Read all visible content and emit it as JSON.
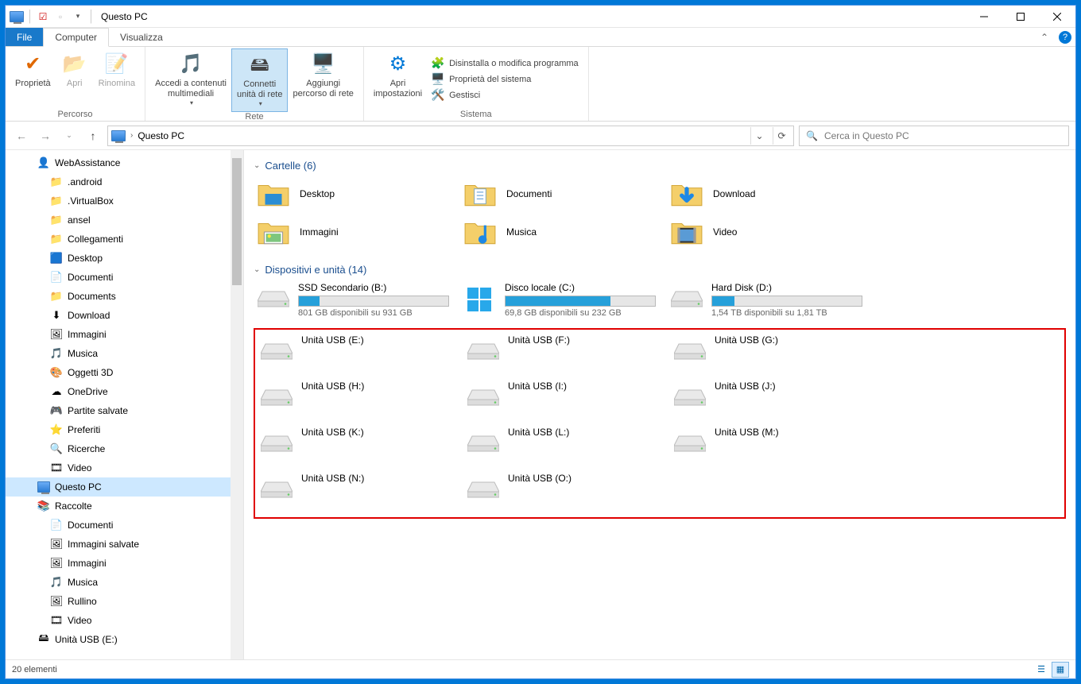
{
  "window": {
    "title": "Questo PC",
    "tabs": {
      "file": "File",
      "computer": "Computer",
      "view": "Visualizza"
    }
  },
  "ribbon": {
    "percorso": {
      "label": "Percorso",
      "properties": "Proprietà",
      "open": "Apri",
      "rename": "Rinomina"
    },
    "rete": {
      "label": "Rete",
      "media": "Accedi a contenuti\nmultimediali",
      "mapdrive": "Connetti\nunità di rete",
      "addloc": "Aggiungi\npercorso di rete"
    },
    "sistema": {
      "label": "Sistema",
      "settings": "Apri\nimpostazioni",
      "uninstall": "Disinstalla o modifica programma",
      "sysprops": "Proprietà del sistema",
      "manage": "Gestisci"
    }
  },
  "address": {
    "location": "Questo PC",
    "search_placeholder": "Cerca in Questo PC"
  },
  "nav": {
    "user": "WebAssistance",
    "items_user": [
      ".android",
      ".VirtualBox",
      "ansel",
      "Collegamenti",
      "Desktop",
      "Documenti",
      "Documents",
      "Download",
      "Immagini",
      "Musica",
      "Oggetti 3D",
      "OneDrive",
      "Partite salvate",
      "Preferiti",
      "Ricerche",
      "Video"
    ],
    "thispc": "Questo PC",
    "raccolte": "Raccolte",
    "items_raccolte": [
      "Documenti",
      "Immagini salvate",
      "Immagini",
      "Musica",
      "Rullino",
      "Video"
    ],
    "usb": "Unità USB (E:)"
  },
  "content": {
    "folders_header": "Cartelle (6)",
    "drives_header": "Dispositivi e unità (14)",
    "folders": [
      "Desktop",
      "Documenti",
      "Download",
      "Immagini",
      "Musica",
      "Video"
    ],
    "drives_storage": [
      {
        "name": "SSD Secondario (B:)",
        "info": "801 GB disponibili su 931 GB",
        "fill": 14
      },
      {
        "name": "Disco locale (C:)",
        "info": "69,8 GB disponibili su 232 GB",
        "fill": 70,
        "os": true
      },
      {
        "name": "Hard Disk (D:)",
        "info": "1,54 TB disponibili su 1,81 TB",
        "fill": 15
      }
    ],
    "drives_usb": [
      "Unità USB (E:)",
      "Unità USB (F:)",
      "Unità USB (G:)",
      "Unità USB (H:)",
      "Unità USB (I:)",
      "Unità USB (J:)",
      "Unità USB (K:)",
      "Unità USB (L:)",
      "Unità USB (M:)",
      "Unità USB (N:)",
      "Unità USB (O:)"
    ]
  },
  "status": {
    "count": "20 elementi"
  }
}
